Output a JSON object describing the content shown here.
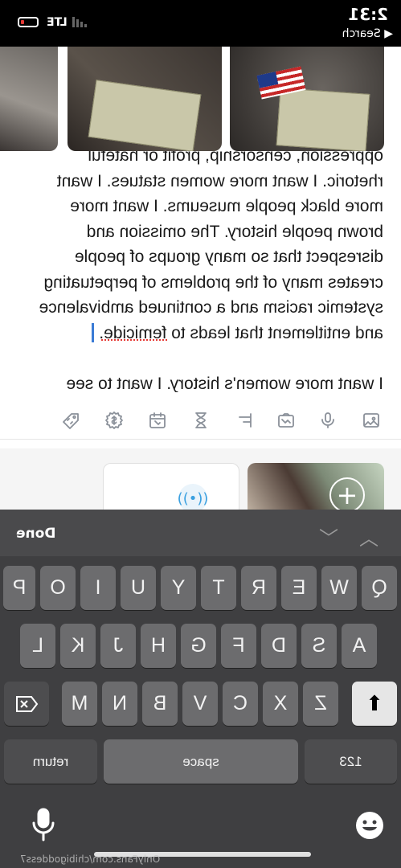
{
  "status_bar": {
    "time": "2:31",
    "back_label": "◀ Search",
    "network": "LTE",
    "battery_color": "#e53935"
  },
  "editor": {
    "lines": [
      "oppression, censorship, profit or hateful",
      "rhetoric. I want more women statues. I want",
      "more black people museums. I want more",
      "brown people history. The omission and",
      "disrespect that so many groups of people",
      "creates many of the problems of perpetuating",
      "systemic racism and a continued ambivalence",
      "and entitlement that leads to"
    ],
    "last_word": "femicide.",
    "next_paragraph": "I want more women's history. I want to see"
  },
  "toolbar": {
    "icons": [
      "image-icon",
      "microphone-icon",
      "camera-icon",
      "poll-icon",
      "hourglass-icon",
      "calendar-icon",
      "price-icon",
      "tag-icon"
    ]
  },
  "keyboard": {
    "done_label": "Done",
    "row1": [
      "Q",
      "W",
      "E",
      "R",
      "T",
      "Y",
      "U",
      "I",
      "O",
      "P"
    ],
    "row2": [
      "A",
      "S",
      "D",
      "F",
      "G",
      "H",
      "J",
      "K",
      "L"
    ],
    "row3": [
      "Z",
      "X",
      "C",
      "V",
      "B",
      "N",
      "M"
    ],
    "num_label": "123",
    "space_label": "space",
    "return_label": "return"
  },
  "watermark": "OnlyFans.com/chibigoddess7"
}
